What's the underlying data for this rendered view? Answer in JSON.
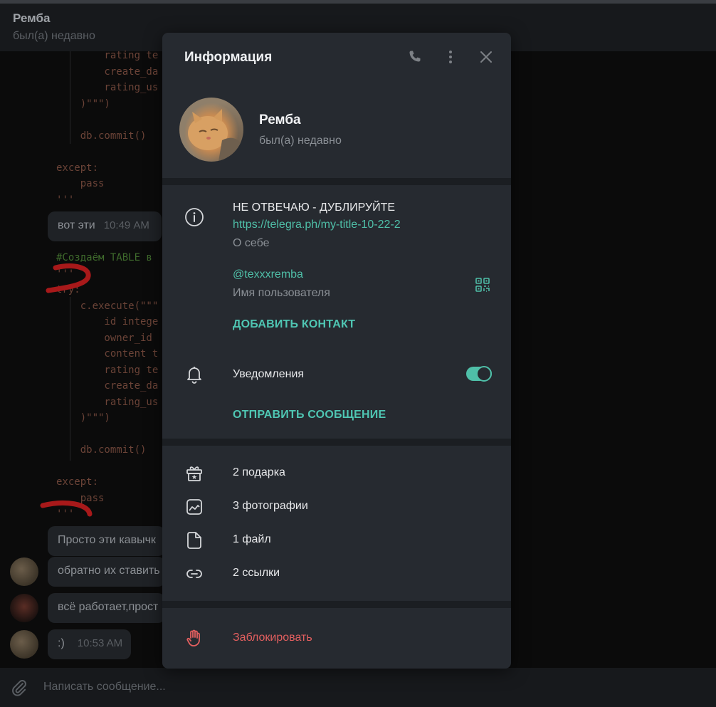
{
  "chat": {
    "name": "Ремба",
    "status": "был(а) недавно",
    "input_placeholder": "Написать сообщение...",
    "code_top": [
      "        rating te",
      "        create_da",
      "        rating_us",
      "    )\"\"\")",
      "",
      "    db.commit()",
      "",
      "except:",
      "    pass",
      "'''"
    ],
    "code_bottom": [
      "#Создаём TABLE в",
      "'''",
      "try:",
      "    c.execute(\"\"\"",
      "        id intege",
      "        owner_id",
      "        content t",
      "        rating te",
      "        create_da",
      "        rating_us",
      "    )\"\"\")",
      "",
      "    db.commit()",
      "",
      "except:",
      "    pass",
      "'''"
    ],
    "messages": [
      {
        "text": "вот эти",
        "time": "10:49 AM"
      },
      {
        "text": "Просто эти кавычк"
      },
      {
        "text": "обратно их ставить"
      },
      {
        "text": "всё работает,прост"
      },
      {
        "text": ":)",
        "time": "10:53 AM"
      }
    ]
  },
  "modal": {
    "title": "Информация",
    "name": "Ремба",
    "status": "был(а) недавно",
    "bio": "НЕ ОТВЕЧАЮ - ДУБЛИРУЙТЕ",
    "bio_link": "https://telegra.ph/my-title-10-22-2",
    "bio_label": "О себе",
    "username": "@texxxremba",
    "username_label": "Имя пользователя",
    "add_contact": "ДОБАВИТЬ КОНТАКТ",
    "notifications": "Уведомления",
    "notifications_on": true,
    "send_message": "ОТПРАВИТЬ СООБЩЕНИЕ",
    "media": {
      "gifts": "2 подарка",
      "photos": "3 фотографии",
      "files": "1 файл",
      "links": "2 ссылки"
    },
    "block": "Заблокировать"
  },
  "colors": {
    "accent": "#4fbfa8",
    "danger": "#e35f5f",
    "panel": "#262a30"
  }
}
